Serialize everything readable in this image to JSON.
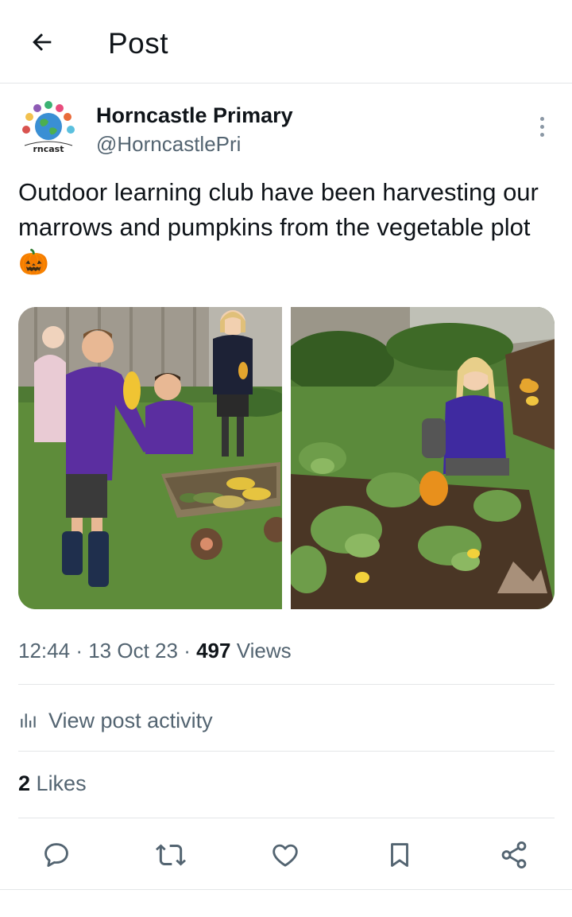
{
  "header": {
    "title": "Post",
    "back_icon": "arrow-left-icon"
  },
  "post": {
    "author_name": "Horncastle Primary",
    "author_handle": "@HorncastlePri",
    "avatar_caption": "rncast",
    "text": "Outdoor learning club have been harvesting our marrows and pumpkins from the vegetable plot 🎃",
    "time": "12:44",
    "date": "13 Oct 23",
    "views_count": "497",
    "views_label": "Views",
    "separator": "·"
  },
  "activity": {
    "label": "View post activity",
    "icon": "bar-chart-icon"
  },
  "likes": {
    "count": "2",
    "label": "Likes"
  },
  "actions": [
    "reply-icon",
    "retweet-icon",
    "like-icon",
    "bookmark-icon",
    "share-icon"
  ],
  "colors": {
    "text": "#0f1419",
    "secondary": "#536471",
    "divider": "#e4e6e8"
  }
}
